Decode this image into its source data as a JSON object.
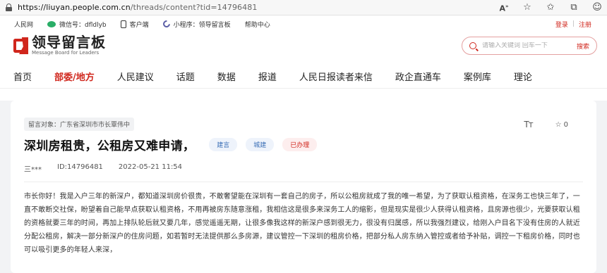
{
  "browser": {
    "url_host": "https://liuyan.people.com.cn",
    "url_path": "/threads/content?tid=14796481"
  },
  "topbar": {
    "items": [
      "人民网",
      "微信号：dfldlyb",
      "客户端",
      "小程序：领导留言板",
      "帮助中心"
    ],
    "login": "登录",
    "separator": "|",
    "register": "注册"
  },
  "logo": {
    "cn": "领导留言板",
    "en": "Message Board for Leaders"
  },
  "search": {
    "placeholder": "请输入关键词 回车一下",
    "button": "搜索"
  },
  "nav": [
    "首页",
    "部委/地方",
    "人民建议",
    "话题",
    "数据",
    "报道",
    "人民日报读者来信",
    "政企直通车",
    "案例库",
    "理论"
  ],
  "nav_active_index": 1,
  "post": {
    "target": "留言对象：广东省深圳市市长覃伟中",
    "title": "深圳房租贵，公租房又难申请，",
    "tags": [
      "建言",
      "城建",
      "已办理"
    ],
    "author": "三***",
    "id": "ID:14796481",
    "datetime": "2022-05-21 11:54",
    "font_tool": "Tт",
    "favorites": "0",
    "content": "市长你好！我是入户三年的新深户，都知道深圳房价很贵，不敢奢望能在深圳有一套自己的房子，所以公租房就成了我的唯一希望，为了获取认租资格，在深务工也快三年了，一直不敢断交社保，盼望着自己能早点获取认租资格，不用再被房东随意涨租，我相信这是很多来深务工人的缩影，但是现实是很少人获得认租资格，且房源也很少，光要获取认租的资格就要三年的时间，再加上排队轮后就又要几年，感觉遥遥无期，让很多像我这样的新深户感到很无力，很没有归属感，所以我强烈建议，给刚入户目名下没有住房的人就近分配公租房，解决一部分新深户的住房问题，如若暂时无法提供那么多房源，建议管控一下深圳的租房价格，把部分私人房东纳入管控或者给予补贴，调控一下租房价格，同时也可以吸引更多的年轻人来深，"
  },
  "colors": {
    "accent": "#d0261c",
    "tag_blue": "#3b6fb6"
  }
}
